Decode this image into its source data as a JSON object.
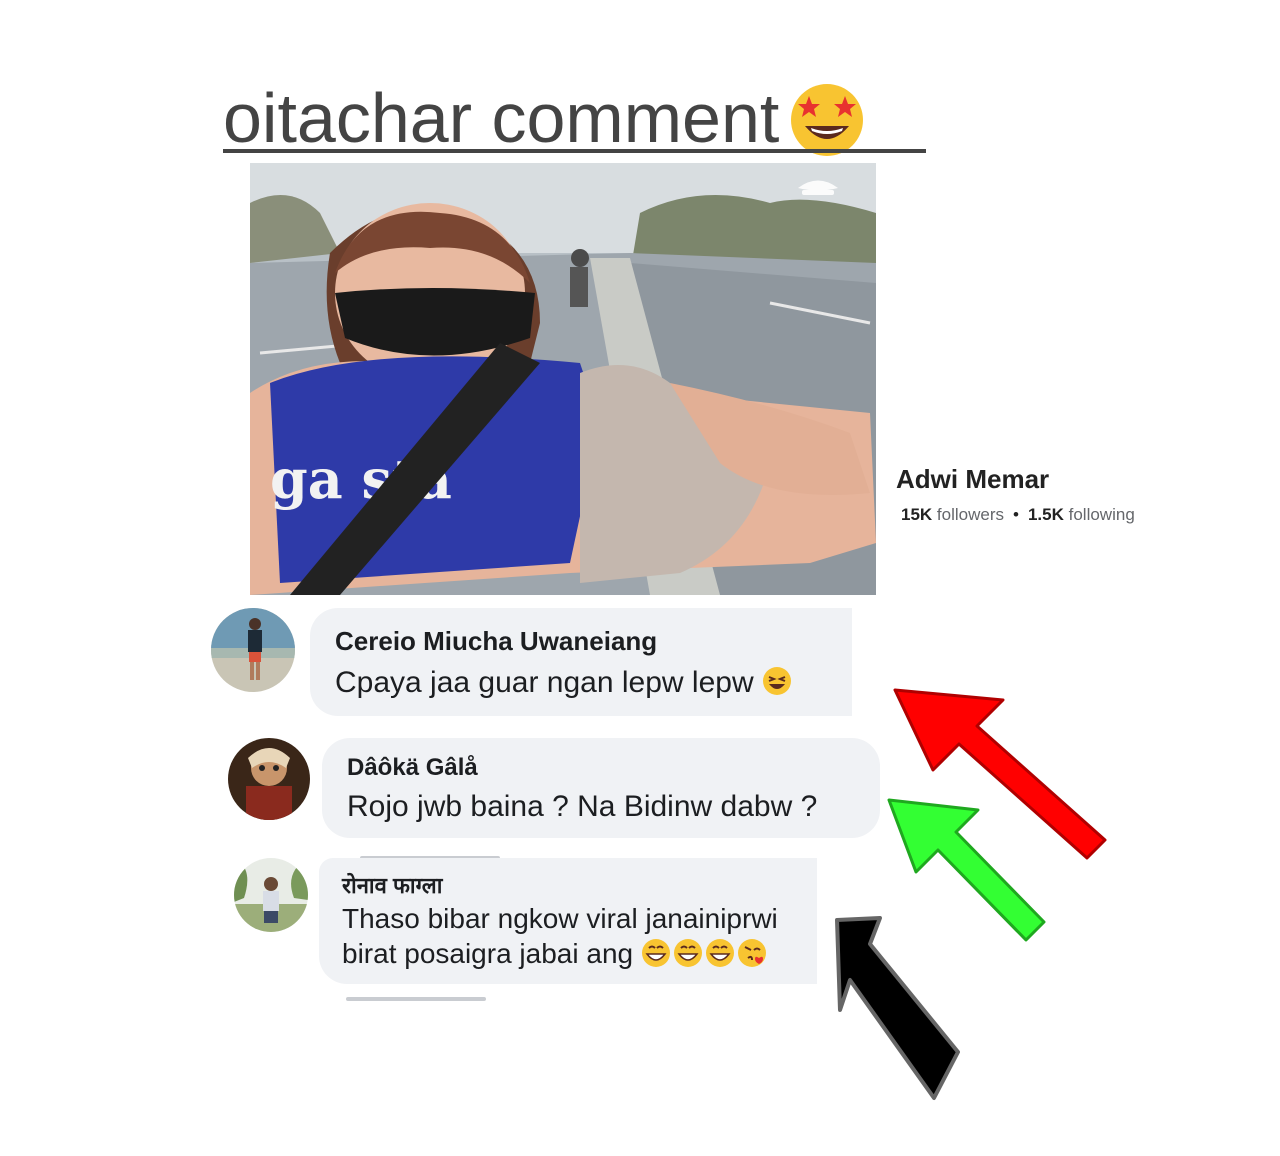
{
  "headline": "oitachar comment",
  "headline_emoji": "star-struck",
  "profile": {
    "name": "Adwi Memar",
    "followers_count": "15K",
    "followers_label": "followers",
    "following_count": "1.5K",
    "following_label": "following"
  },
  "comments": [
    {
      "author": "Cereio Miucha Uwaneiang",
      "text": "Cpaya jaa guar ngan lepw lepw"
    },
    {
      "author": "Dâôkä Gâlå",
      "text": "Rojo jwb baina ? Na Bidinw dabw ?"
    },
    {
      "author": "रोनाव फाग्ला",
      "text_line1": "Thaso bibar ngkow viral janainiprwi",
      "text_line2": "birat posaigra jabai ang"
    }
  ],
  "arrows": [
    {
      "color": "#ff0000",
      "name": "red-arrow"
    },
    {
      "color": "#33ff33",
      "name": "green-arrow"
    },
    {
      "color": "#000000",
      "name": "black-arrow"
    }
  ]
}
